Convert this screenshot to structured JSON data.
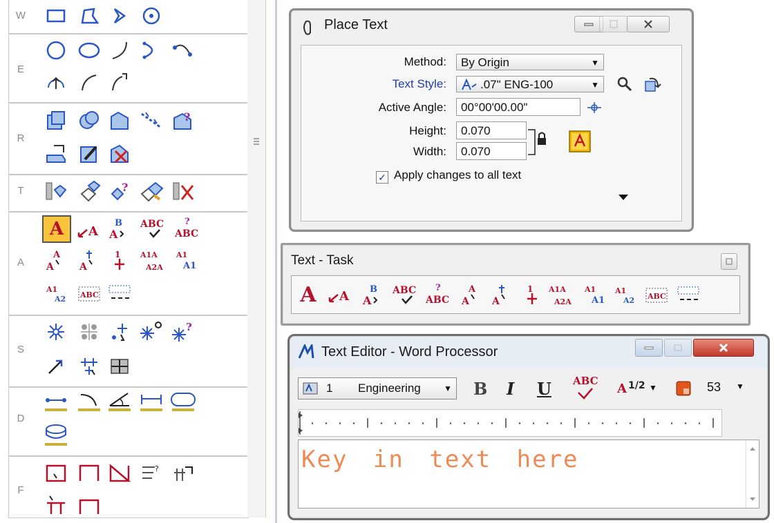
{
  "palette": {
    "rows": [
      {
        "letter": "W"
      },
      {
        "letter": "E"
      },
      {
        "letter": "R"
      },
      {
        "letter": "T"
      },
      {
        "letter": "A"
      },
      {
        "letter": "S"
      },
      {
        "letter": "D"
      },
      {
        "letter": "F"
      }
    ],
    "text_tool_labels": {
      "place_text": "A",
      "place_note": "A",
      "edit_text": "ABC",
      "spell": "ABC",
      "display_text_attr": "ABC",
      "glyph_b": "B",
      "enter_data_a1a": "A1A",
      "enter_data_a2a": "A2A"
    }
  },
  "place_text": {
    "title": "Place Text",
    "method_label": "Method:",
    "method_value": "By Origin",
    "text_style_label": "Text Style:",
    "text_style_value": ".07\"  ENG-100",
    "active_angle_label": "Active Angle:",
    "active_angle_value": "00°00'00.00\"",
    "height_label": "Height:",
    "height_value": "0.070",
    "width_label": "Width:",
    "width_value": "0.070",
    "apply_label": "Apply changes to all text",
    "apply_checked": true
  },
  "text_task": {
    "title": "Text - Task",
    "tools": [
      "A",
      "A",
      "A",
      "ABC",
      "ABC",
      "A",
      "A",
      "1",
      "A1A",
      "A1",
      "A1",
      "ABC",
      ""
    ]
  },
  "text_editor": {
    "title": "Text Editor - Word Processor",
    "style_number": "1",
    "style_name": "Engineering",
    "bold": "B",
    "italic": "I",
    "underline": "U",
    "spell": "ABC",
    "fraction": "A",
    "fraction_digits": "1/2",
    "size_value": "53",
    "placeholder_text": "Key in text here"
  },
  "colors": {
    "text_tool_red": "#b7102a",
    "link_blue": "#1f3fae",
    "icon_blue": "#2a56c6",
    "editor_placeholder": "#ee8a55"
  }
}
